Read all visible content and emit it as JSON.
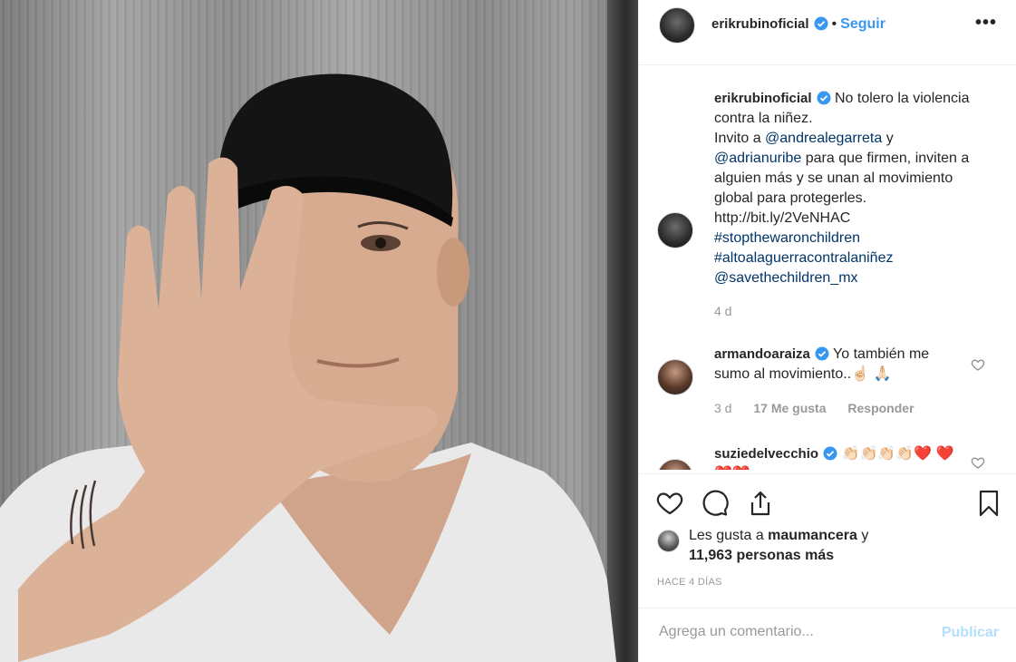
{
  "post": {
    "image_alt": "Man in black cap holding up open palm"
  },
  "header": {
    "username": "erikrubinoficial",
    "dot": "•",
    "follow_label": "Seguir",
    "more_label": "•••"
  },
  "caption": {
    "username": "erikrubinoficial",
    "line1": "No tolero la violencia contra la niñez.",
    "line2_pre": "Invito a ",
    "mention1": "@andrealegarreta",
    "line2_mid": " y ",
    "mention2": "@adrianuribe",
    "line2_post": " para que firmen, inviten a alguien más y se unan al movimiento global para protegerles.",
    "url": "http://bit.ly/2VeNHAC",
    "hashtag1": "#stopthewaronchildren",
    "hashtag2": "#altoalaguerracontralaniñez",
    "mention3": "@savethechildren_mx",
    "time": "4 d"
  },
  "comments": [
    {
      "username": "armandoaraiza",
      "text": "Yo también me sumo al movimiento..☝🏻 🙏🏻",
      "time": "3 d",
      "likes": "17 Me gusta",
      "reply": "Responder"
    },
    {
      "username": "suziedelvecchio",
      "text": "👏🏻👏🏻👏🏻👏🏻❤️ ❤️❤️❤️"
    }
  ],
  "likes": {
    "prefix": "Les gusta a ",
    "user": "maumancera",
    "suffix": " y",
    "count_text": "11,963 personas más"
  },
  "date": "HACE 4 DÍAS",
  "add_comment": {
    "placeholder": "Agrega un comentario...",
    "publish_label": "Publicar"
  },
  "colors": {
    "accent": "#3897f0",
    "link": "#003569",
    "muted": "#999999",
    "border": "#efefef",
    "publish_disabled": "#b2dffc"
  }
}
